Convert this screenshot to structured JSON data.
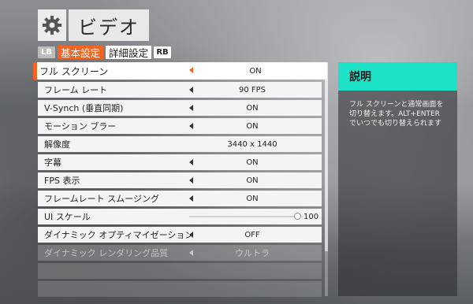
{
  "header": {
    "title": "ビデオ",
    "icon": "gear-icon"
  },
  "tabs": {
    "left_key": "LB",
    "items": [
      {
        "label": "基本設定",
        "active": true
      },
      {
        "label": "詳細設定",
        "active": false
      }
    ],
    "right_key": "RB"
  },
  "settings": [
    {
      "label": "フル スクリーン",
      "value": "ON",
      "type": "option",
      "selected": true
    },
    {
      "label": "フレーム レート",
      "value": "90 FPS",
      "type": "option"
    },
    {
      "label": "V-Synch (垂直同期)",
      "value": "ON",
      "type": "option"
    },
    {
      "label": "モーション ブラー",
      "value": "ON",
      "type": "option"
    },
    {
      "label": "解像度",
      "value": "3440 x 1440",
      "type": "readonly"
    },
    {
      "label": "字幕",
      "value": "ON",
      "type": "option"
    },
    {
      "label": "FPS 表示",
      "value": "ON",
      "type": "option"
    },
    {
      "label": "フレームレート スムージング",
      "value": "ON",
      "type": "option"
    },
    {
      "label": "UI スケール",
      "value": "100",
      "type": "slider",
      "slider_fraction": 1.0
    },
    {
      "label": "ダイナミック オプティマイゼーション",
      "value": "OFF",
      "type": "option"
    },
    {
      "label": "ダイナミック レンダリング品質",
      "value": "ウルトラ",
      "type": "disabled"
    }
  ],
  "description": {
    "title": "説明",
    "text": "フル スクリーンと通常画面を切り替えます。ALT+ENTER でいつでも切り替えられます"
  },
  "colors": {
    "accent": "#f26522",
    "panel_header": "#1de2c8"
  }
}
